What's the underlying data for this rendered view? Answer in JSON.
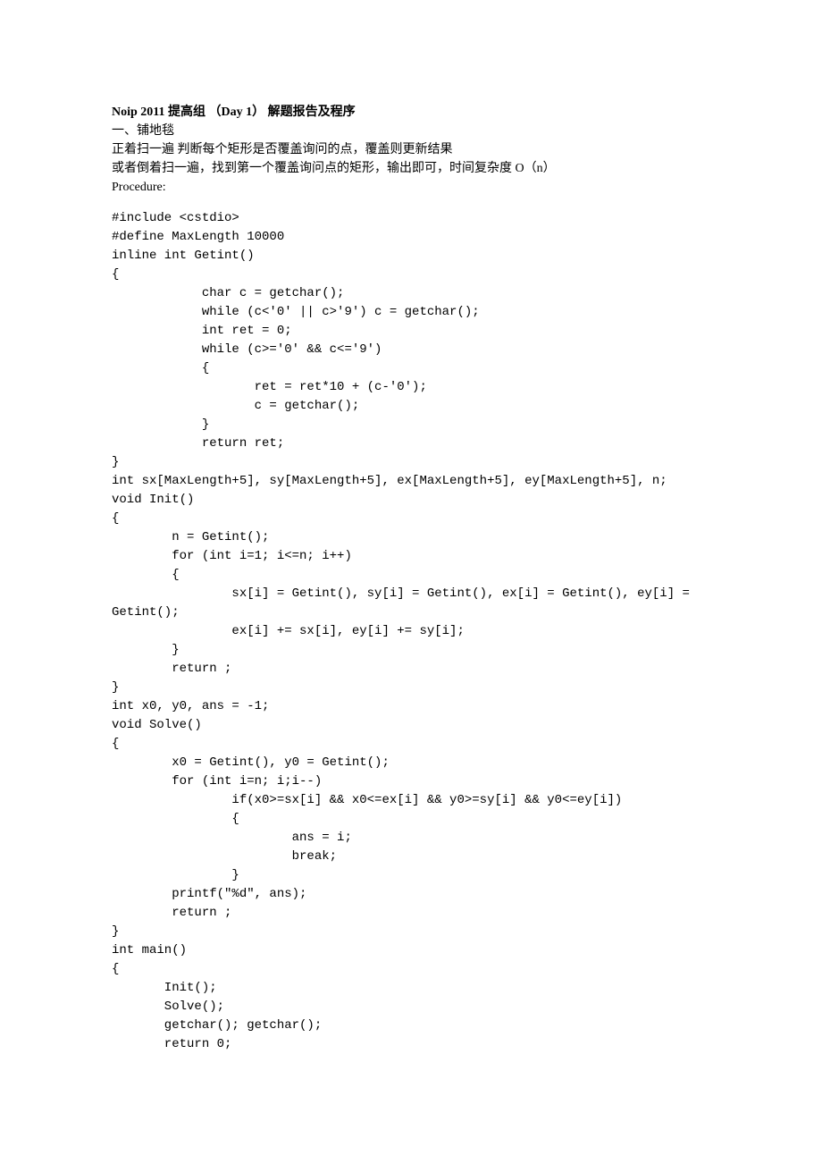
{
  "title": "Noip 2011 提高组 （Day 1） 解题报告及程序",
  "section_heading": "一、铺地毯",
  "desc_line1": "正着扫一遍 判断每个矩形是否覆盖询问的点，覆盖则更新结果",
  "desc_line2": "或者倒着扫一遍，找到第一个覆盖询问点的矩形，输出即可，时间复杂度 O（n）",
  "procedure_label": "Procedure:",
  "code": "#include <cstdio>\n#define MaxLength 10000\ninline int Getint()\n{\n            char c = getchar();\n            while (c<'0' || c>'9') c = getchar();\n            int ret = 0;\n            while (c>='0' && c<='9')\n            {\n                   ret = ret*10 + (c-'0');\n                   c = getchar();\n            }\n            return ret;\n}\nint sx[MaxLength+5], sy[MaxLength+5], ex[MaxLength+5], ey[MaxLength+5], n;\nvoid Init()\n{\n        n = Getint();\n        for (int i=1; i<=n; i++)\n        {\n                sx[i] = Getint(), sy[i] = Getint(), ex[i] = Getint(), ey[i] = \nGetint();\n                ex[i] += sx[i], ey[i] += sy[i];\n        }\n        return ;\n}\nint x0, y0, ans = -1;\nvoid Solve()\n{\n        x0 = Getint(), y0 = Getint();\n        for (int i=n; i;i--)\n                if(x0>=sx[i] && x0<=ex[i] && y0>=sy[i] && y0<=ey[i])\n                {\n                        ans = i;\n                        break;\n                }\n        printf(\"%d\", ans);\n        return ;\n}\nint main()\n{\n       Init();\n       Solve();\n       getchar(); getchar();\n       return 0;"
}
